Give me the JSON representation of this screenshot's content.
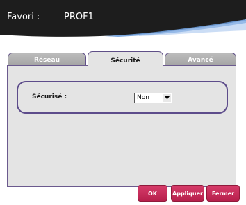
{
  "header": {
    "label": "Favori :",
    "profile": "PROF1"
  },
  "tabs": [
    {
      "label": "Réseau",
      "active": false
    },
    {
      "label": "Sécurité",
      "active": true
    },
    {
      "label": "Avancé",
      "active": false
    }
  ],
  "security": {
    "secured_label": "Sécurisé :",
    "secured_value": "Non"
  },
  "buttons": {
    "ok": "OK",
    "apply": "Appliquer",
    "close": "Fermer"
  },
  "colors": {
    "header_bg": "#1d1d1d",
    "header_wave": "#6e9fdc",
    "panel_bg": "#e4e4e4",
    "border_accent": "#5d4c8b",
    "button_bg": "#c8285a"
  }
}
